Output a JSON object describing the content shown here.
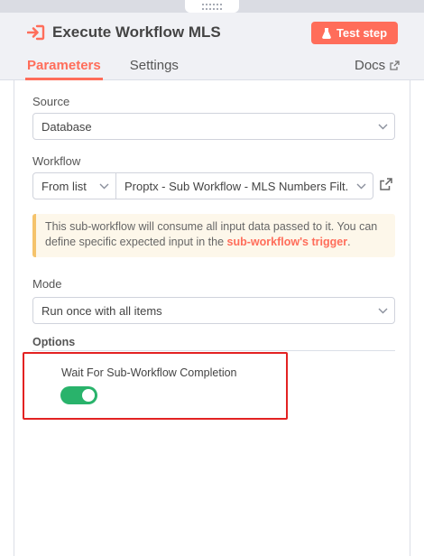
{
  "node": {
    "title": "Execute Workflow MLS",
    "test_button_label": "Test step"
  },
  "tabs": [
    {
      "label": "Parameters"
    },
    {
      "label": "Settings"
    }
  ],
  "docs_label": "Docs",
  "source": {
    "label": "Source",
    "value": "Database"
  },
  "workflow": {
    "label": "Workflow",
    "mode_value": "From list",
    "selected_value": "Proptx - Sub Workflow - MLS Numbers Filt..."
  },
  "notice": {
    "text_before": "This sub-workflow will consume all input data passed to it. You can define specific expected input in the ",
    "link_text": "sub-workflow's trigger",
    "text_after": "."
  },
  "mode": {
    "label": "Mode",
    "value": "Run once with all items"
  },
  "options": {
    "title": "Options",
    "wait_label": "Wait For Sub-Workflow Completion",
    "wait_enabled": true
  },
  "colors": {
    "accent": "#ff6d5a",
    "toggle_on": "#29b36b",
    "highlight": "#e32222",
    "notice_border": "#f5c36b"
  }
}
